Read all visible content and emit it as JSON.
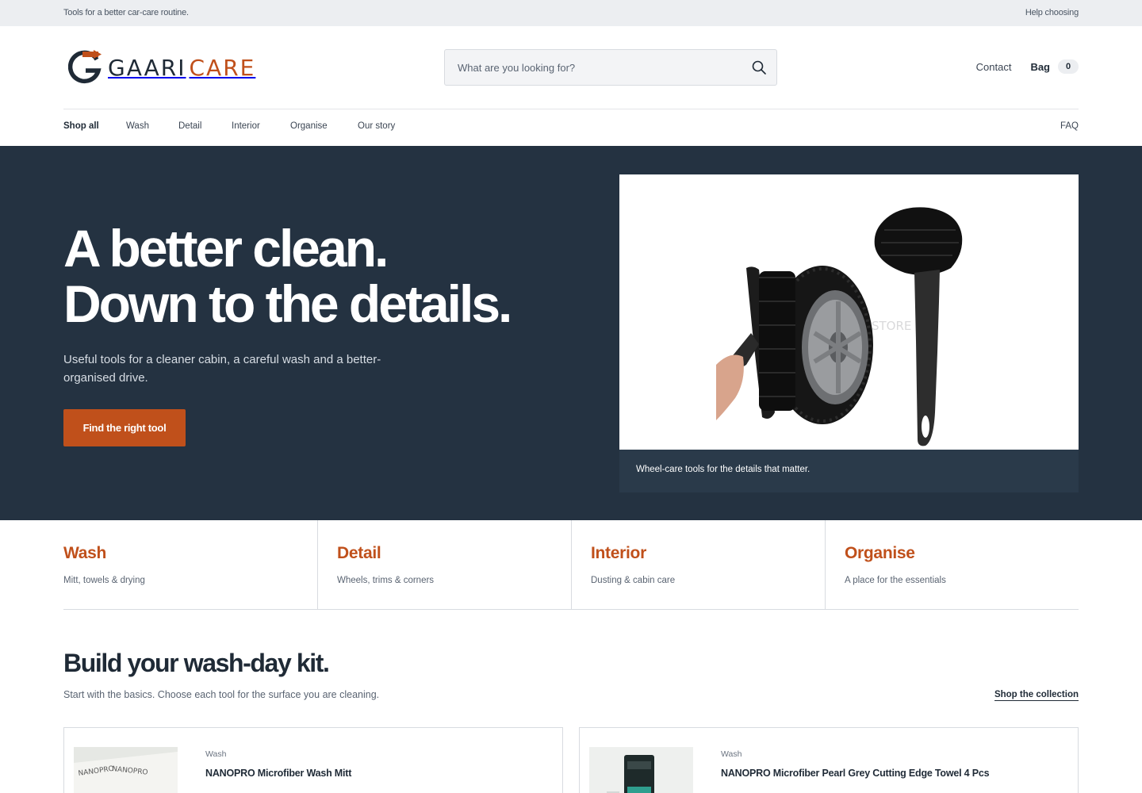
{
  "topbar": {
    "tagline": "Tools for a better car-care routine.",
    "help_link": "Help choosing"
  },
  "brand": {
    "name_part1": "GAARI",
    "name_part2": "CARE",
    "accent_color": "#c0501b",
    "dark_color": "#1f2a36"
  },
  "search": {
    "placeholder": "What are you looking for?",
    "value": "",
    "icon": "search-icon"
  },
  "header": {
    "contact_label": "Contact",
    "bag_label": "Bag",
    "bag_count": "0"
  },
  "nav": {
    "items": [
      {
        "label": "Shop all",
        "active": true
      },
      {
        "label": "Wash"
      },
      {
        "label": "Detail"
      },
      {
        "label": "Interior"
      },
      {
        "label": "Organise"
      },
      {
        "label": "Our story"
      }
    ],
    "faq_label": "FAQ"
  },
  "hero": {
    "title_line1": "A better clean.",
    "title_line2": "Down to the details.",
    "subtitle": "Useful tools for a cleaner cabin, a careful wash and a better-organised drive.",
    "cta_label": "Find the right tool",
    "image_caption": "Wheel-care tools for the details that matter.",
    "watermark_text": "STORE",
    "background_color": "#243241"
  },
  "categories": [
    {
      "title": "Wash",
      "desc": "Mitt, towels & drying"
    },
    {
      "title": "Detail",
      "desc": "Wheels, trims & corners"
    },
    {
      "title": "Interior",
      "desc": "Dusting & cabin care"
    },
    {
      "title": "Organise",
      "desc": "A place for the essentials"
    }
  ],
  "kit": {
    "title": "Build your wash-day kit.",
    "subtitle": "Start with the basics. Choose each tool for the surface you are cleaning.",
    "link_label": "Shop the collection"
  },
  "products": [
    {
      "category": "Wash",
      "name": "NANOPRO Microfiber Wash Mitt",
      "image_text": "NANOPRO"
    },
    {
      "category": "Wash",
      "name": "NANOPRO Microfiber Pearl Grey Cutting Edge Towel 4 Pcs"
    }
  ]
}
